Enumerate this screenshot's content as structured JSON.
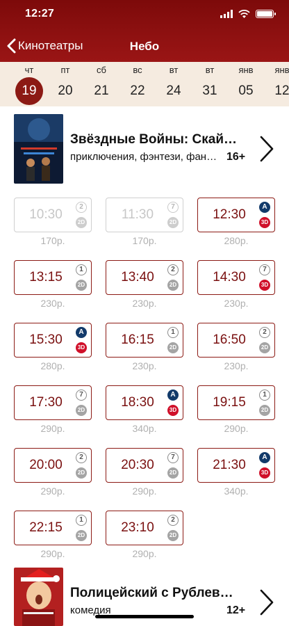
{
  "status_bar": {
    "time": "12:27"
  },
  "nav": {
    "back_label": "Кинотеатры",
    "title": "Небо"
  },
  "colors": {
    "header": "#8f1111",
    "accent": "#8c1a14",
    "date_bar": "#f5ebe0",
    "badge_3d": "#d0102a",
    "badge_2d": "#a4a4a4"
  },
  "dates": [
    {
      "dow": "чт",
      "day": "19",
      "selected": true
    },
    {
      "dow": "пт",
      "day": "20"
    },
    {
      "dow": "сб",
      "day": "21"
    },
    {
      "dow": "вс",
      "day": "22"
    },
    {
      "dow": "вт",
      "day": "24"
    },
    {
      "dow": "вт",
      "day": "31"
    },
    {
      "dow": "янв",
      "day": "05"
    },
    {
      "dow": "янв",
      "day": "12"
    }
  ],
  "movies": [
    {
      "title": "Звёздные Войны: Скайуокер. Восход",
      "genres": "приключения, фэнтези, фантастика",
      "age": "16+",
      "sessions": [
        {
          "time": "10:30",
          "age_badge": "2",
          "format": "2D",
          "price": "170р.",
          "past": true
        },
        {
          "time": "11:30",
          "age_badge": "7",
          "format": "2D",
          "price": "170р.",
          "past": true
        },
        {
          "time": "12:30",
          "age_badge": "A",
          "format": "3D",
          "price": "280р."
        },
        {
          "time": "13:15",
          "age_badge": "1",
          "format": "2D",
          "price": "230р."
        },
        {
          "time": "13:40",
          "age_badge": "2",
          "format": "2D",
          "price": "230р."
        },
        {
          "time": "14:30",
          "age_badge": "7",
          "format": "3D",
          "price": "230р."
        },
        {
          "time": "15:30",
          "age_badge": "A",
          "format": "3D",
          "price": "280р."
        },
        {
          "time": "16:15",
          "age_badge": "1",
          "format": "2D",
          "price": "230р."
        },
        {
          "time": "16:50",
          "age_badge": "2",
          "format": "2D",
          "price": "230р."
        },
        {
          "time": "17:30",
          "age_badge": "7",
          "format": "2D",
          "price": "290р."
        },
        {
          "time": "18:30",
          "age_badge": "A",
          "format": "3D",
          "price": "340р."
        },
        {
          "time": "19:15",
          "age_badge": "1",
          "format": "2D",
          "price": "290р."
        },
        {
          "time": "20:00",
          "age_badge": "2",
          "format": "2D",
          "price": "290р."
        },
        {
          "time": "20:30",
          "age_badge": "7",
          "format": "2D",
          "price": "290р."
        },
        {
          "time": "21:30",
          "age_badge": "A",
          "format": "3D",
          "price": "340р."
        },
        {
          "time": "22:15",
          "age_badge": "1",
          "format": "2D",
          "price": "290р."
        },
        {
          "time": "23:10",
          "age_badge": "2",
          "format": "2D",
          "price": "290р."
        }
      ]
    },
    {
      "title": "Полицейский с Рублевки. Новогодний беспредел",
      "genres": "комедия",
      "age": "12+"
    }
  ],
  "icons": {
    "back": "chevron-left-icon",
    "open": "chevron-right-icon",
    "wifi": "wifi-icon",
    "battery": "battery-icon",
    "signal": "signal-icon"
  }
}
